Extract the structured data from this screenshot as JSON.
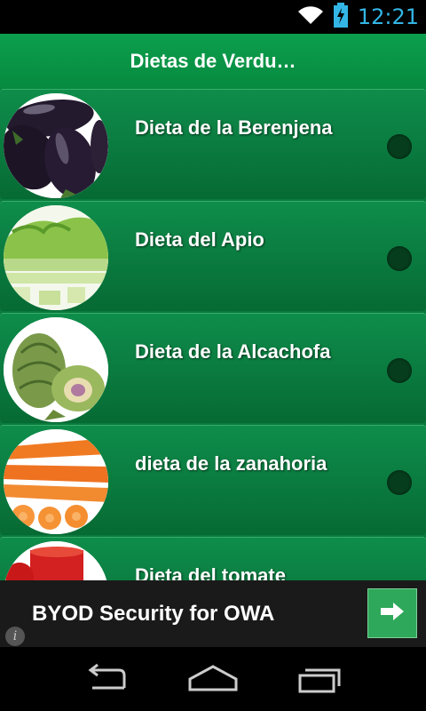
{
  "status_bar": {
    "time": "12:21"
  },
  "action_bar": {
    "title": "Dietas de Verdu…"
  },
  "items": [
    {
      "label": "Dieta de la Berenjena",
      "image": "eggplant"
    },
    {
      "label": "Dieta del Apio",
      "image": "celery"
    },
    {
      "label": "Dieta de la Alcachofa",
      "image": "artichoke"
    },
    {
      "label": "dieta de la zanahoria",
      "image": "carrot"
    },
    {
      "label": "Dieta del tomate",
      "image": "tomato"
    }
  ],
  "ad": {
    "text": "BYOD Security for OWA",
    "info_glyph": "i"
  },
  "colors": {
    "accent": "#0a8a44",
    "time": "#33b5e5",
    "ad_button": "#2ea85a"
  }
}
